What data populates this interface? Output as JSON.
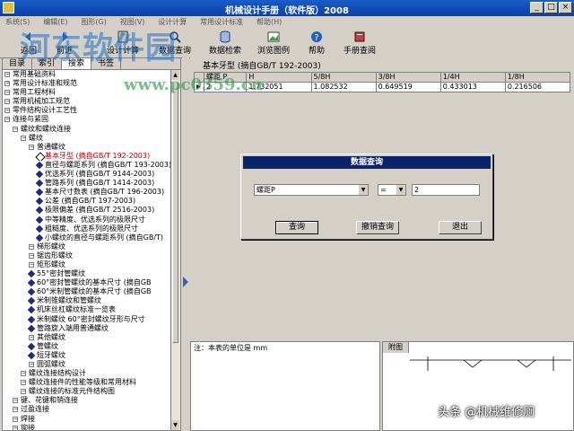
{
  "window": {
    "title": "机械设计手册（软件版）2008",
    "minimize": "_",
    "maximize": "□",
    "close": "×"
  },
  "menu": [
    "系统(S)",
    "编辑(E)",
    "图形(G)",
    "视图(V)",
    "设计计算",
    "常用设计标准",
    "帮助(H)"
  ],
  "toolbar": [
    {
      "label": "返回",
      "icon": "back-icon"
    },
    {
      "label": "前进",
      "icon": "forward-icon"
    },
    {
      "label": "设计计算",
      "icon": "calculator-icon"
    },
    {
      "label": "数据查询",
      "icon": "search-icon"
    },
    {
      "label": "数据检索",
      "icon": "database-icon"
    },
    {
      "label": "浏览图例",
      "icon": "image-icon"
    },
    {
      "label": "帮助",
      "icon": "help-icon"
    },
    {
      "label": "手册查阅",
      "icon": "book-icon"
    }
  ],
  "watermark": {
    "text": "河东软件园",
    "url": "www.pc0359.cn"
  },
  "left_tabs": [
    "目录",
    "索引",
    "搜索",
    "书签"
  ],
  "tree": [
    {
      "indent": 0,
      "type": "exp",
      "text": "常用基础资料"
    },
    {
      "indent": 0,
      "type": "exp",
      "text": "常用设计标准和规范"
    },
    {
      "indent": 0,
      "type": "exp",
      "text": "常用工程材料"
    },
    {
      "indent": 0,
      "type": "exp",
      "text": "常用机械加工规范"
    },
    {
      "indent": 0,
      "type": "exp",
      "text": "零件结构设计工艺性"
    },
    {
      "indent": 0,
      "type": "exp",
      "text": "连接与紧固"
    },
    {
      "indent": 1,
      "type": "exp",
      "text": "螺纹和螺纹连接"
    },
    {
      "indent": 2,
      "type": "exp",
      "text": "螺纹"
    },
    {
      "indent": 3,
      "type": "exp",
      "text": "普通螺纹"
    },
    {
      "indent": 4,
      "type": "sel",
      "text": "基本牙型 (摘自GB/T 192-2003)"
    },
    {
      "indent": 4,
      "type": "diam",
      "text": "直径与螺距系列 (摘自GB/T 193-2003)"
    },
    {
      "indent": 4,
      "type": "diam",
      "text": "优选系列 (摘自GB/T 9144-2003)"
    },
    {
      "indent": 4,
      "type": "diam",
      "text": "管路系列 (摘自GB/T 1414-2003)"
    },
    {
      "indent": 4,
      "type": "diam",
      "text": "基本尺寸数表 (摘自GB/T 196-2003)"
    },
    {
      "indent": 4,
      "type": "diam",
      "text": "公差 (摘自GB/T 197-2003)"
    },
    {
      "indent": 4,
      "type": "diam",
      "text": "极限偏差 (摘自GB/T 2516-2003)"
    },
    {
      "indent": 4,
      "type": "diam",
      "text": "中等精度、优选系列的极限尺寸"
    },
    {
      "indent": 4,
      "type": "diam",
      "text": "粗糙度、优选系列的极限尺寸"
    },
    {
      "indent": 4,
      "type": "diam",
      "text": "小螺纹的直径与螺距系列 (摘自GB/T)"
    },
    {
      "indent": 3,
      "type": "exp",
      "text": "梯形螺纹"
    },
    {
      "indent": 3,
      "type": "exp",
      "text": "锯齿形螺纹"
    },
    {
      "indent": 3,
      "type": "exp",
      "text": "矩形螺纹"
    },
    {
      "indent": 3,
      "type": "diam",
      "text": "55°密封管螺纹"
    },
    {
      "indent": 3,
      "type": "diam",
      "text": "60°密封管螺纹的基本尺寸 (摘自GB"
    },
    {
      "indent": 3,
      "type": "diam",
      "text": "60°米制管螺纹的基本尺寸 (摘自GB"
    },
    {
      "indent": 3,
      "type": "diam",
      "text": "米制锥螺纹和管螺纹"
    },
    {
      "indent": 3,
      "type": "diam",
      "text": "机床丝杠螺纹标准一览表"
    },
    {
      "indent": 3,
      "type": "diam",
      "text": "米制螺纹 60°密封螺纹牙形与尺寸"
    },
    {
      "indent": 3,
      "type": "diam",
      "text": "管路旋入端用普通螺纹"
    },
    {
      "indent": 3,
      "type": "exp",
      "text": "其他螺纹"
    },
    {
      "indent": 3,
      "type": "diam",
      "text": "管螺纹"
    },
    {
      "indent": 3,
      "type": "diam",
      "text": "短牙螺纹"
    },
    {
      "indent": 3,
      "type": "exp",
      "text": "圆弧螺纹"
    },
    {
      "indent": 2,
      "type": "exp",
      "text": "螺纹连接结构设计"
    },
    {
      "indent": 2,
      "type": "exp",
      "text": "螺纹连接件的性能等级和常用材料"
    },
    {
      "indent": 2,
      "type": "exp",
      "text": "螺纹连接的标准元件结构图"
    },
    {
      "indent": 1,
      "type": "exp",
      "text": "键、花键和销连接"
    },
    {
      "indent": 1,
      "type": "exp",
      "text": "过盈连接"
    },
    {
      "indent": 1,
      "type": "exp",
      "text": "焊接"
    },
    {
      "indent": 1,
      "type": "exp",
      "text": "铆接"
    }
  ],
  "main": {
    "caption": "基本牙型 (摘自GB/T 192-2003)",
    "columns": [
      "螺距 P",
      "H",
      "5/8H",
      "3/8H",
      "1/4H",
      "1/8H"
    ],
    "rows": [
      [
        "2",
        "1.732051",
        "1.082532",
        "0.649519",
        "0.433013",
        "0.216506"
      ]
    ]
  },
  "dialog": {
    "title": "数据查询",
    "field": "螺距P",
    "operator": "=",
    "value": "2",
    "query_btn": "查询",
    "cancel_btn": "撤销查询",
    "exit_btn": "退出"
  },
  "memo": "注：本表的单位是 mm",
  "pic_tab": "附图",
  "brand": "头条 @机械维修厕"
}
